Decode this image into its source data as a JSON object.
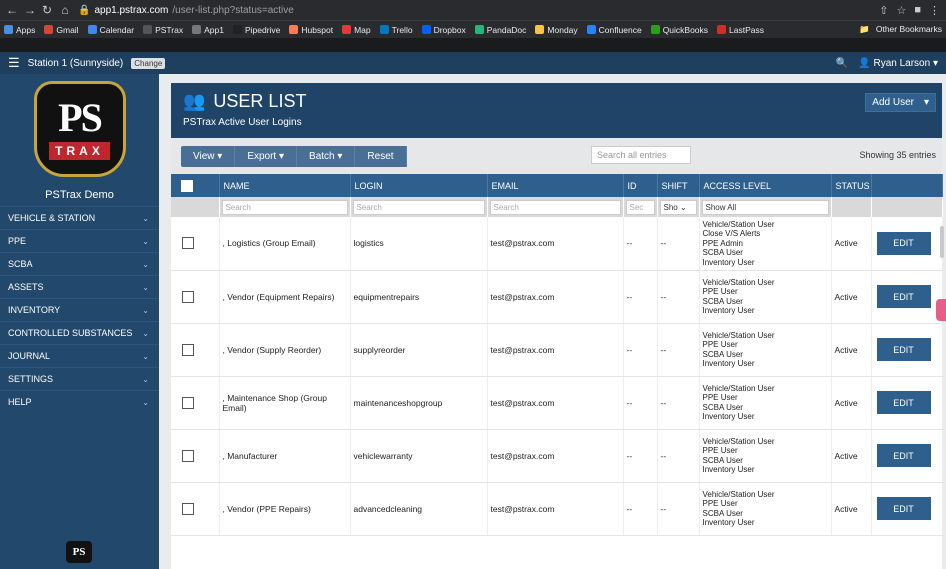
{
  "browser": {
    "url_host": "app1.pstrax.com",
    "url_path": "/user-list.php?status=active",
    "profile": "Other Bookmarks"
  },
  "bookmarks": [
    {
      "label": "Apps",
      "color": "#4a90e2"
    },
    {
      "label": "Gmail",
      "color": "#d44638"
    },
    {
      "label": "Calendar",
      "color": "#4285f4"
    },
    {
      "label": "PSTrax",
      "color": "#555555"
    },
    {
      "label": "App1",
      "color": "#777777"
    },
    {
      "label": "Pipedrive",
      "color": "#222222"
    },
    {
      "label": "Hubspot",
      "color": "#ff7a59"
    },
    {
      "label": "Map",
      "color": "#e53935"
    },
    {
      "label": "Trello",
      "color": "#0079bf"
    },
    {
      "label": "Dropbox",
      "color": "#0061ff"
    },
    {
      "label": "PandaDoc",
      "color": "#26b67c"
    },
    {
      "label": "Monday",
      "color": "#f6c342"
    },
    {
      "label": "Confluence",
      "color": "#2684ff"
    },
    {
      "label": "QuickBooks",
      "color": "#2ca01c"
    },
    {
      "label": "LastPass",
      "color": "#d32d27"
    }
  ],
  "topnav": {
    "station": "Station 1 (Sunnyside)",
    "change": "Change",
    "user": "Ryan Larson"
  },
  "sidebar": {
    "brand": "PSTrax Demo",
    "logo_ps": "PS",
    "logo_trax": "TRAX",
    "items": [
      {
        "label": "VEHICLE & STATION"
      },
      {
        "label": "PPE"
      },
      {
        "label": "SCBA"
      },
      {
        "label": "ASSETS"
      },
      {
        "label": "INVENTORY"
      },
      {
        "label": "CONTROLLED SUBSTANCES"
      },
      {
        "label": "JOURNAL"
      },
      {
        "label": "SETTINGS"
      },
      {
        "label": "HELP"
      }
    ]
  },
  "header": {
    "title": "USER LIST",
    "subtitle": "PSTrax Active User Logins",
    "add_user": "Add User"
  },
  "toolbar": {
    "view": "View",
    "export": "Export",
    "batch": "Batch",
    "reset": "Reset",
    "search_placeholder": "Search all entries",
    "showing": "Showing 35 entries"
  },
  "columns": {
    "name": "NAME",
    "login": "LOGIN",
    "email": "EMAIL",
    "id": "ID",
    "shift": "SHIFT",
    "access": "ACCESS LEVEL",
    "status": "STATUS"
  },
  "filters": {
    "search": "Search",
    "sec": "Sec",
    "sho": "Sho",
    "show_all": "Show All"
  },
  "rows": [
    {
      "name": ", Logistics (Group Email)",
      "login": "logistics",
      "email": "test@pstrax.com",
      "id": "--",
      "shift": "--",
      "access": [
        "Vehicle/Station User",
        "Close V/S Alerts",
        "PPE Admin",
        "SCBA User",
        "Inventory User"
      ],
      "status": "Active",
      "edit": "EDIT"
    },
    {
      "name": ", Vendor (Equipment Repairs)",
      "login": "equipmentrepairs",
      "email": "test@pstrax.com",
      "id": "--",
      "shift": "--",
      "access": [
        "Vehicle/Station User",
        "PPE User",
        "SCBA User",
        "Inventory User"
      ],
      "status": "Active",
      "edit": "EDIT"
    },
    {
      "name": ", Vendor (Supply Reorder)",
      "login": "supplyreorder",
      "email": "test@pstrax.com",
      "id": "--",
      "shift": "--",
      "access": [
        "Vehicle/Station User",
        "PPE User",
        "SCBA User",
        "Inventory User"
      ],
      "status": "Active",
      "edit": "EDIT"
    },
    {
      "name": ", Maintenance Shop (Group Email)",
      "login": "maintenanceshopgroup",
      "email": "test@pstrax.com",
      "id": "--",
      "shift": "--",
      "access": [
        "Vehicle/Station User",
        "PPE User",
        "SCBA User",
        "Inventory User"
      ],
      "status": "Active",
      "edit": "EDIT"
    },
    {
      "name": ", Manufacturer",
      "login": "vehiclewarranty",
      "email": "test@pstrax.com",
      "id": "--",
      "shift": "--",
      "access": [
        "Vehicle/Station User",
        "PPE User",
        "SCBA User",
        "Inventory User"
      ],
      "status": "Active",
      "edit": "EDIT"
    },
    {
      "name": ", Vendor (PPE Repairs)",
      "login": "advancedcleaning",
      "email": "test@pstrax.com",
      "id": "--",
      "shift": "--",
      "access": [
        "Vehicle/Station User",
        "PPE User",
        "SCBA User",
        "Inventory User"
      ],
      "status": "Active",
      "edit": "EDIT"
    }
  ]
}
